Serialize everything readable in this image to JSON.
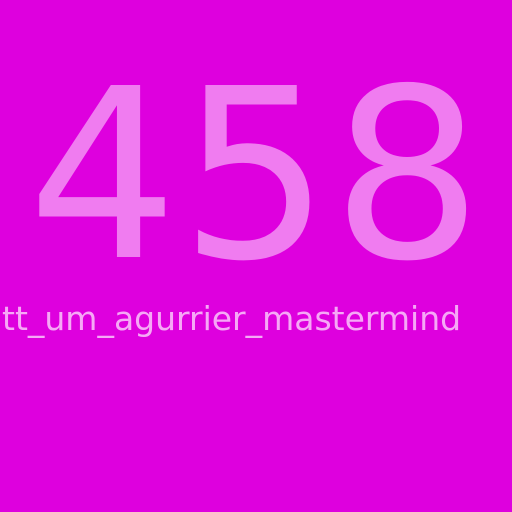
{
  "display": {
    "number": "458",
    "label": "tt_um_agurrier_mastermind"
  },
  "colors": {
    "background": "#de00de",
    "number": "#f07cf0",
    "label": "#f6a8f6"
  }
}
